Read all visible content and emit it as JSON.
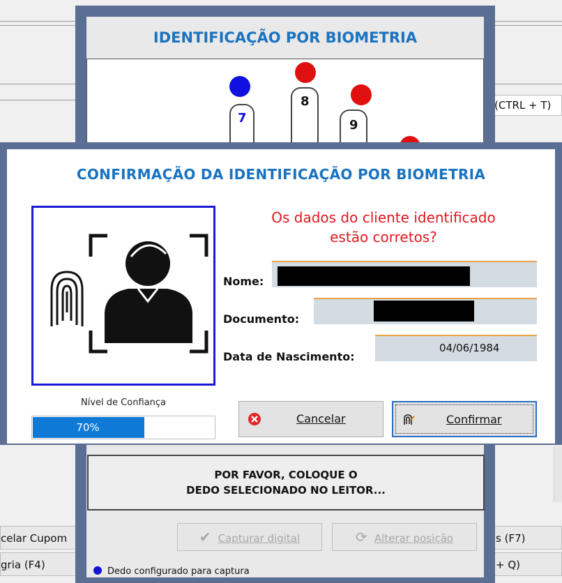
{
  "background_app": {
    "partial_labels": {
      "ctrl_t": "(CTRL + T)",
      "cancelar_cupom": "celar Cupom",
      "f7": "s (F7)",
      "alegria_f4": "gria (F4)",
      "ctrl_q": "+ Q)"
    }
  },
  "biometric_window": {
    "title": "IDENTIFICAÇÃO POR BIOMETRIA",
    "fingers": [
      {
        "number": "7",
        "dot_color": "#1010e0",
        "number_color": "#1010e0"
      },
      {
        "number": "8",
        "dot_color": "#e01010",
        "number_color": "#111111"
      },
      {
        "number": "9",
        "dot_color": "#e01010",
        "number_color": "#111111"
      }
    ],
    "instruction_line1": "POR FAVOR, COLOQUE O",
    "instruction_line2": "DEDO SELECIONADO NO LEITOR...",
    "capture_button": "Capturar digital",
    "change_position_button": "Alterar posição",
    "legend_text": "Dedo configurado para captura"
  },
  "confirmation_dialog": {
    "title": "CONFIRMAÇÃO DA IDENTIFICAÇÃO POR BIOMETRIA",
    "question_line1": "Os dados do cliente identificado",
    "question_line2": "estão corretos?",
    "fields": {
      "nome_label": "Nome:",
      "documento_label": "Documento:",
      "nascimento_label": "Data de Nascimento:",
      "nascimento_value": "04/06/1984"
    },
    "confidence_label": "Nível de Confiança",
    "confidence_value": 0.7,
    "confidence_text": "70%",
    "cancel_button": "Cancelar",
    "confirm_button": "Confirmar"
  },
  "colors": {
    "title_blue": "#1a73c0",
    "question_red": "#e0181f",
    "frame": "#5b6e93",
    "progress": "#0f79d6"
  }
}
